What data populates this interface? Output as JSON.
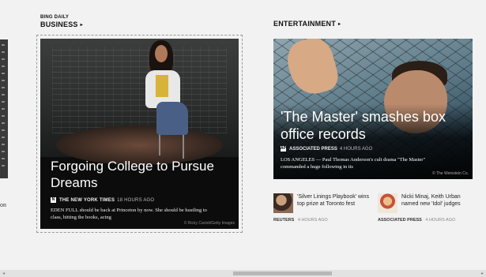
{
  "left_edge": {
    "snippet": "on"
  },
  "business": {
    "section_small": "BING DAILY",
    "section_big": "BUSINESS",
    "arrow": "▸",
    "headline": "Forgoing College to Pursue Dreams",
    "source_badge": "N",
    "source": "THE NEW YORK TIMES",
    "time": "18 HOURS AGO",
    "snippet": "EDEN FULL should be back at Princeton by now. She should be hustling to class, hitting the books, acing",
    "credit": "© Ricky Carioti/Getty Images"
  },
  "entertainment": {
    "section_big": "ENTERTAINMENT",
    "arrow": "▸",
    "headline": "'The Master' smashes box office records",
    "source_badge": "AP",
    "source": "ASSOCIATED PRESS",
    "time": "4 HOURS AGO",
    "snippet": "LOS ANGELES — Paul Thomas Anderson's cult drama \"The Master\" commanded a huge following in its",
    "credit": "© The Weinstein Co.",
    "minis": [
      {
        "title": "'Silver Linings Playbook' wins top prize at Toronto fest",
        "source": "REUTERS",
        "time": "4 HOURS AGO"
      },
      {
        "title": "Nicki Minaj, Keith Urban named new 'Idol' judges",
        "source": "ASSOCIATED PRESS",
        "time": "4 HOURS AGO"
      }
    ]
  },
  "scrollbar": {
    "left_arrow": "◂",
    "right_arrow": "▸"
  }
}
